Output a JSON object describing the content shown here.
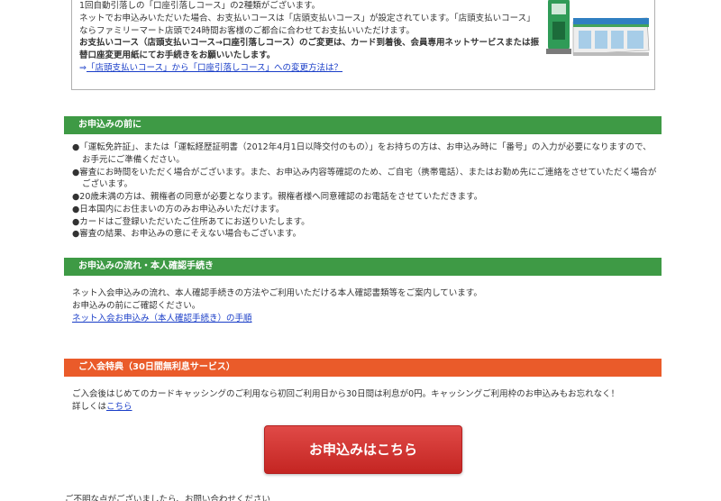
{
  "top_box": {
    "line1": "1回自動引落しの「口座引落しコース」の2種類がございます。",
    "line2": "ネットでお申込みいただいた場合、お支払いコースは「店頭支払いコース」が設定されています。「店頭支払いコース」",
    "line3": "ならファミリーマート店頭で24時間お客様のご都合に合わせてお支払いいただけます。",
    "bold1": "お支払いコース（店頭支払いコース→口座引落しコース）のご変更は、カード到着後、会員専用ネットサービスまたは振",
    "bold2": "替口座変更用紙にてお手続きをお願いいたします。",
    "arrow": "⇒",
    "link": "「店頭支払いコース」から「口座引落しコース」への変更方法は？"
  },
  "section1": {
    "title": "お申込みの前に",
    "items": [
      "●「運転免許証」、または「運転経歴証明書（2012年4月1日以降交付のもの）」をお持ちの方は、お申込み時に「番号」の入力が必要になりますので、",
      "お手元にご準備ください。",
      "●審査にお時間をいただく場合がございます。また、お申込み内容等確認のため、ご自宅（携帯電話）、またはお勤め先にご連絡をさせていただく場合が",
      "ございます。",
      "●20歳未満の方は、親権者の同意が必要となります。親権者様へ同意確認のお電話をさせていただきます。",
      "●日本国内にお住まいの方のみお申込みいただけます。",
      "●カードはご登録いただいたご住所あてにお送りいたします。",
      "●審査の結果、お申込みの意にそえない場合もございます。"
    ]
  },
  "section2": {
    "title": "お申込みの流れ・本人確認手続き",
    "line1": "ネット入会申込みの流れ、本人確認手続きの方法やご利用いただける本人確認書類等をご案内しています。",
    "line2": "お申込みの前にご確認ください。",
    "link": "ネット入会お申込み（本人確認手続き）の手順"
  },
  "section3": {
    "title": "ご入会特典（30日間無利息サービス）",
    "line1": "ご入会後はじめてのカードキャッシングのご利用なら初回ご利用日から30日間は利息が0円。キャッシングご利用枠のお申込みもお忘れなく！",
    "details_prefix": "詳しくは",
    "details_link": "こちら"
  },
  "apply_button": "お申込みはこちら",
  "footer_partial": "ご不明な点がございましたら、お問い合わせください"
}
